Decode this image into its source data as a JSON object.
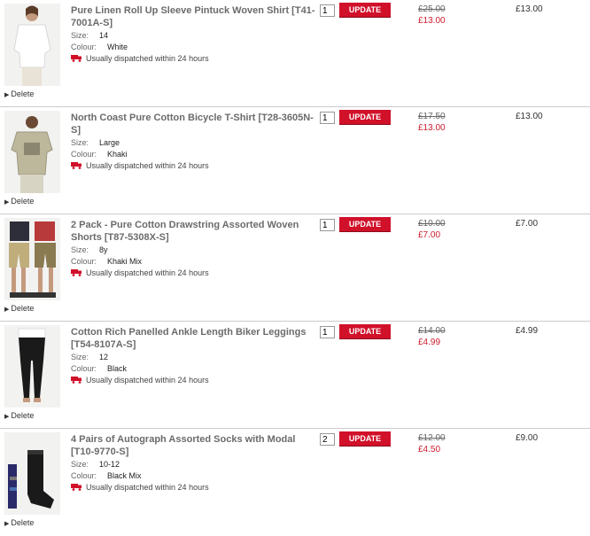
{
  "colors": {
    "accent": "#d1102a",
    "sale_price": "#cc1b2c",
    "divider": "#cccccc"
  },
  "labels": {
    "size": "Size:",
    "colour": "Colour:",
    "dispatch": "Usually dispatched within 24 hours",
    "delete": "Delete",
    "update": "UPDATE"
  },
  "items": [
    {
      "title": "Pure Linen Roll Up Sleeve Pintuck Woven Shirt [T41-7001A-S]",
      "size": "14",
      "colour": "White",
      "qty": "1",
      "was": "£25.00",
      "now": "£13.00",
      "total": "£13.00",
      "image": "white-shirt-icon"
    },
    {
      "title": "North Coast Pure Cotton Bicycle T-Shirt [T28-3605N-S]",
      "size": "Large",
      "colour": "Khaki",
      "qty": "1",
      "was": "£17.50",
      "now": "£13.00",
      "total": "£13.00",
      "image": "khaki-tshirt-icon"
    },
    {
      "title": "2 Pack - Pure Cotton Drawstring Assorted Woven Shorts [T87-5308X-S]",
      "size": "8y",
      "colour": "Khaki Mix",
      "qty": "1",
      "was": "£10.00",
      "now": "£7.00",
      "total": "£7.00",
      "image": "shorts-icon"
    },
    {
      "title": "Cotton Rich Panelled Ankle Length Biker Leggings [T54-8107A-S]",
      "size": "12",
      "colour": "Black",
      "qty": "1",
      "was": "£14.00",
      "now": "£4.99",
      "total": "£4.99",
      "image": "leggings-icon"
    },
    {
      "title": "4 Pairs of Autograph Assorted Socks with Modal [T10-9770-S]",
      "size": "10-12",
      "colour": "Black Mix",
      "qty": "2",
      "was": "£12.00",
      "now": "£4.50",
      "total": "£9.00",
      "image": "socks-icon"
    }
  ]
}
